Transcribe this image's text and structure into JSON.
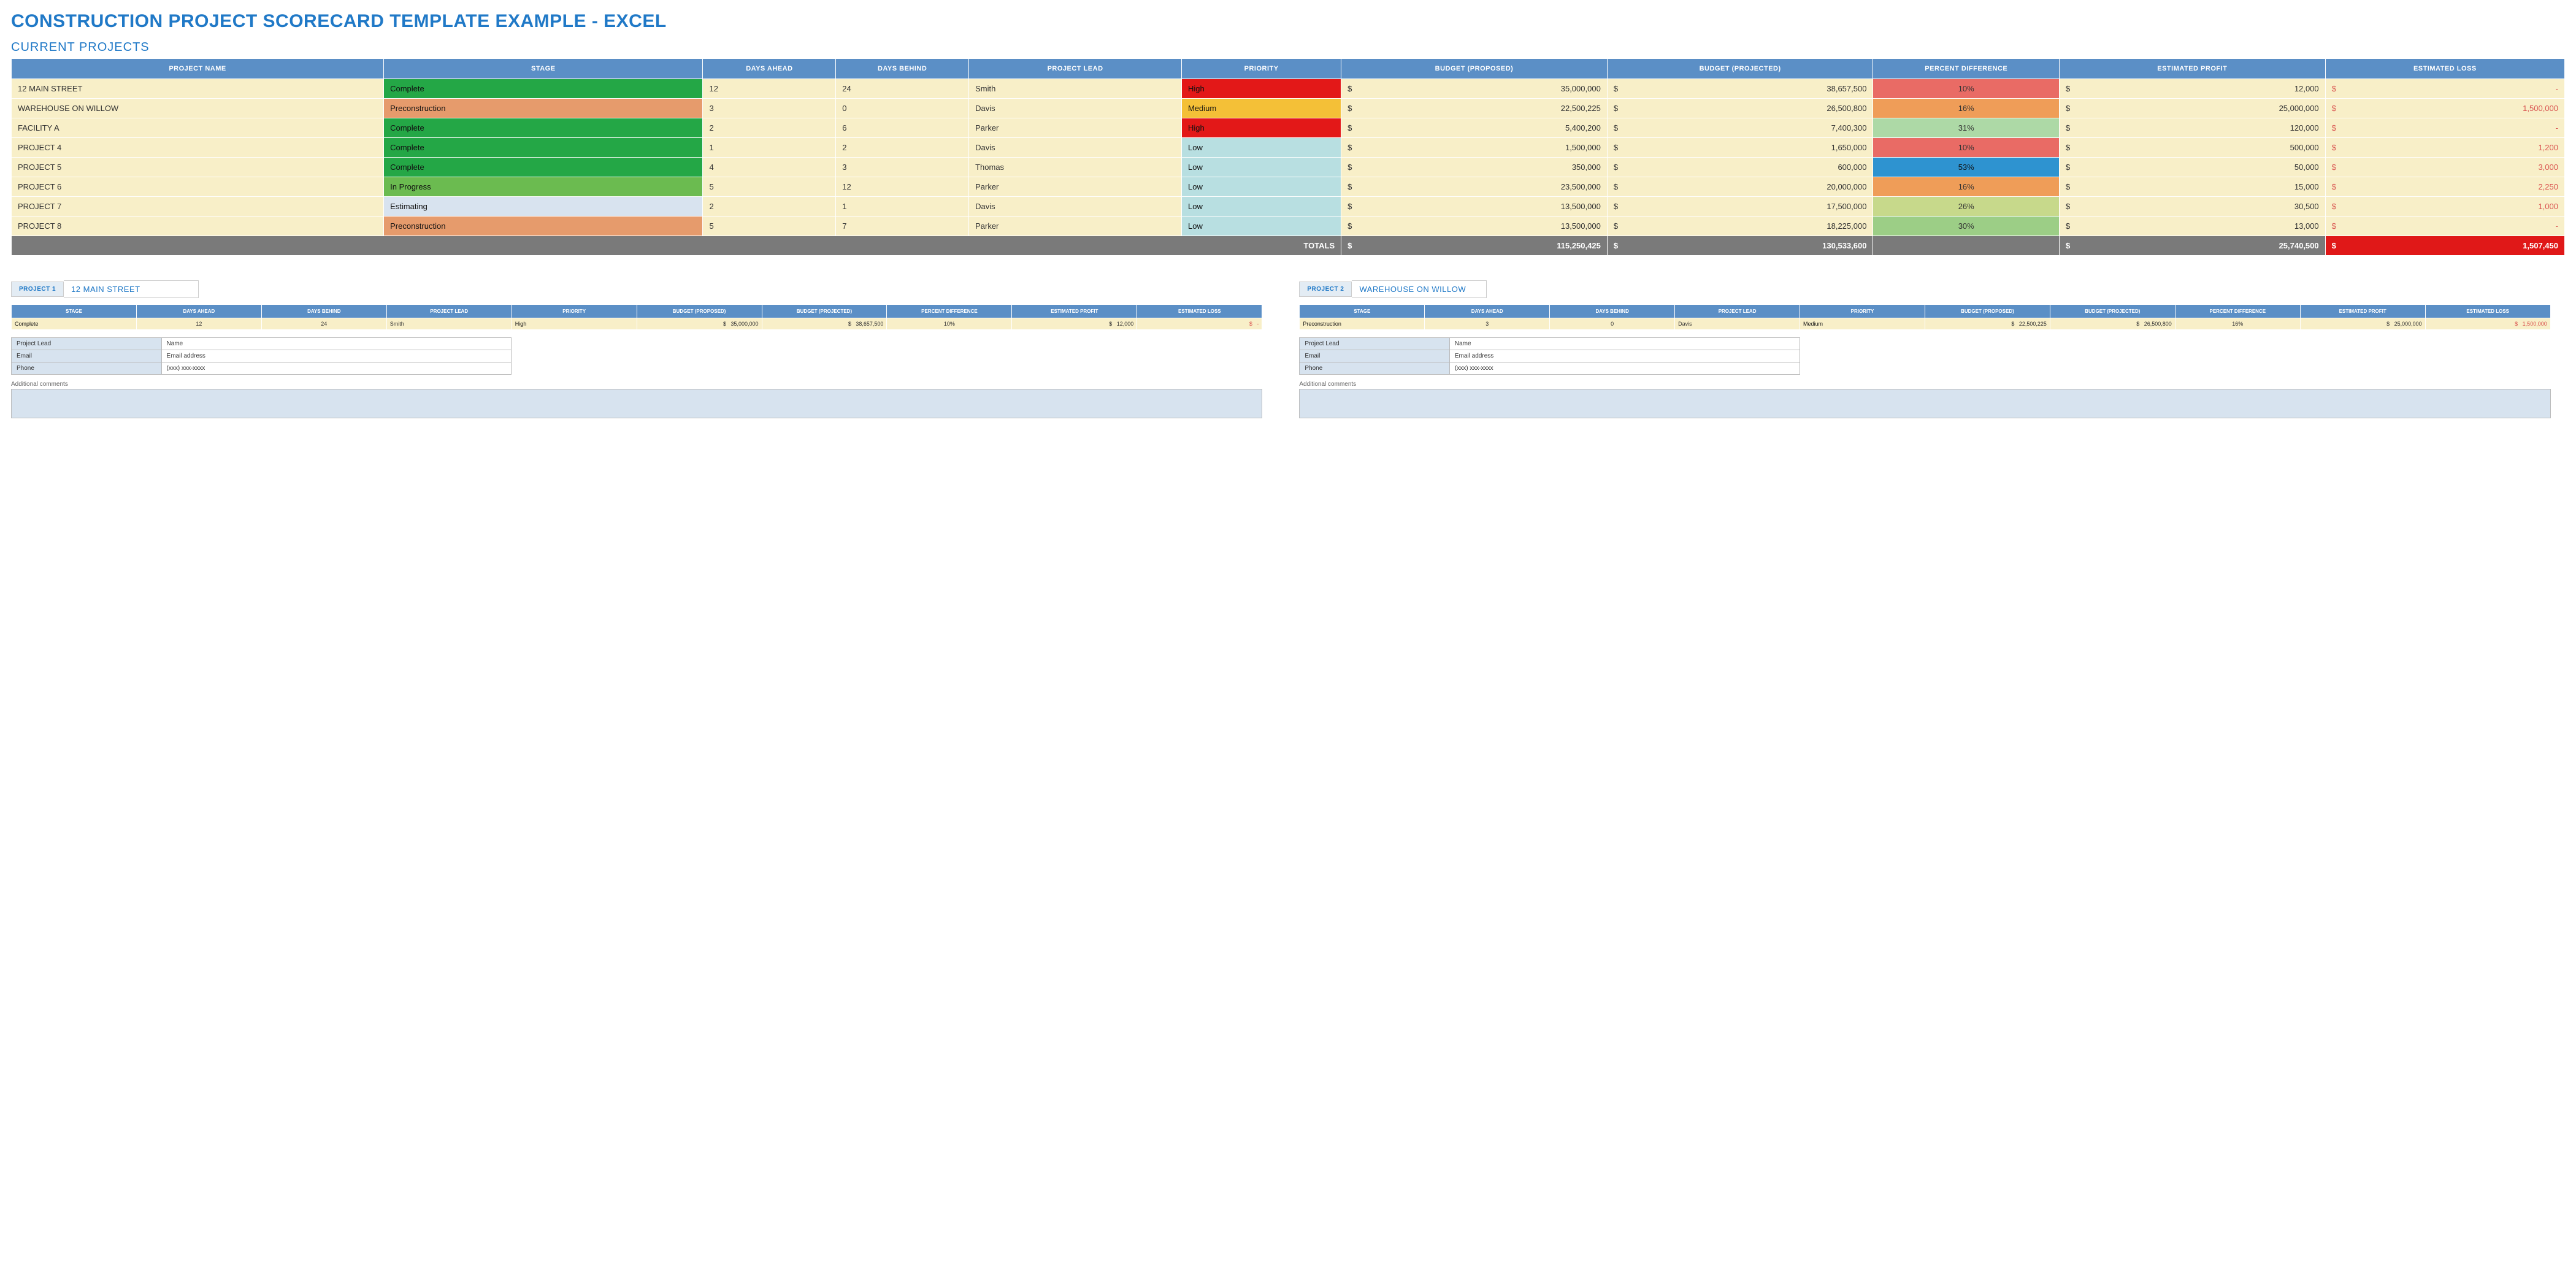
{
  "title": "CONSTRUCTION PROJECT SCORECARD TEMPLATE EXAMPLE - EXCEL",
  "section": "CURRENT PROJECTS",
  "columns": {
    "name": "PROJECT NAME",
    "stage": "STAGE",
    "ahead": "DAYS AHEAD",
    "behind": "DAYS BEHIND",
    "lead": "PROJECT LEAD",
    "priority": "PRIORITY",
    "budget_prop": "BUDGET (PROPOSED)",
    "budget_proj": "BUDGET (PROJECTED)",
    "pct": "PERCENT DIFFERENCE",
    "profit": "ESTIMATED PROFIT",
    "loss": "ESTIMATED LOSS"
  },
  "rows": [
    {
      "name": "12 MAIN STREET",
      "stage": "Complete",
      "ahead": "12",
      "behind": "24",
      "lead": "Smith",
      "priority": "High",
      "budget_prop": "35,000,000",
      "budget_proj": "38,657,500",
      "pct": "10%",
      "pct_class": "pct-red",
      "profit": "12,000",
      "loss": "-"
    },
    {
      "name": "WAREHOUSE ON WILLOW",
      "stage": "Preconstruction",
      "ahead": "3",
      "behind": "0",
      "lead": "Davis",
      "priority": "Medium",
      "budget_prop": "22,500,225",
      "budget_proj": "26,500,800",
      "pct": "16%",
      "pct_class": "pct-orange",
      "profit": "25,000,000",
      "loss": "1,500,000"
    },
    {
      "name": "FACILITY A",
      "stage": "Complete",
      "ahead": "2",
      "behind": "6",
      "lead": "Parker",
      "priority": "High",
      "budget_prop": "5,400,200",
      "budget_proj": "7,400,300",
      "pct": "31%",
      "pct_class": "pct-lightgreen",
      "profit": "120,000",
      "loss": "-"
    },
    {
      "name": "PROJECT 4",
      "stage": "Complete",
      "ahead": "1",
      "behind": "2",
      "lead": "Davis",
      "priority": "Low",
      "budget_prop": "1,500,000",
      "budget_proj": "1,650,000",
      "pct": "10%",
      "pct_class": "pct-red",
      "profit": "500,000",
      "loss": "1,200"
    },
    {
      "name": "PROJECT 5",
      "stage": "Complete",
      "ahead": "4",
      "behind": "3",
      "lead": "Thomas",
      "priority": "Low",
      "budget_prop": "350,000",
      "budget_proj": "600,000",
      "pct": "53%",
      "pct_class": "pct-blue",
      "profit": "50,000",
      "loss": "3,000"
    },
    {
      "name": "PROJECT 6",
      "stage": "In Progress",
      "ahead": "5",
      "behind": "12",
      "lead": "Parker",
      "priority": "Low",
      "budget_prop": "23,500,000",
      "budget_proj": "20,000,000",
      "pct": "16%",
      "pct_class": "pct-orange",
      "profit": "15,000",
      "loss": "2,250"
    },
    {
      "name": "PROJECT 7",
      "stage": "Estimating",
      "ahead": "2",
      "behind": "1",
      "lead": "Davis",
      "priority": "Low",
      "budget_prop": "13,500,000",
      "budget_proj": "17,500,000",
      "pct": "26%",
      "pct_class": "pct-olive",
      "profit": "30,500",
      "loss": "1,000"
    },
    {
      "name": "PROJECT 8",
      "stage": "Preconstruction",
      "ahead": "5",
      "behind": "7",
      "lead": "Parker",
      "priority": "Low",
      "budget_prop": "13,500,000",
      "budget_proj": "18,225,000",
      "pct": "30%",
      "pct_class": "pct-green2",
      "profit": "13,000",
      "loss": "-"
    }
  ],
  "totals": {
    "label": "TOTALS",
    "budget_prop": "115,250,425",
    "budget_proj": "130,533,600",
    "profit": "25,740,500",
    "loss": "1,507,450"
  },
  "cards": [
    {
      "label": "PROJECT 1",
      "name": "12 MAIN STREET",
      "row": {
        "stage": "Complete",
        "ahead": "12",
        "behind": "24",
        "lead": "Smith",
        "priority": "High",
        "budget_prop": "35,000,000",
        "budget_proj": "38,657,500",
        "pct": "10%",
        "profit": "12,000",
        "loss": "-"
      },
      "stage_class": "Complete",
      "pri_class": "High"
    },
    {
      "label": "PROJECT 2",
      "name": "WAREHOUSE ON WILLOW",
      "row": {
        "stage": "Preconstruction",
        "ahead": "3",
        "behind": "0",
        "lead": "Davis",
        "priority": "Medium",
        "budget_prop": "22,500,225",
        "budget_proj": "26,500,800",
        "pct": "16%",
        "profit": "25,000,000",
        "loss": "1,500,000"
      },
      "stage_class": "Preconstruction",
      "pri_class": "Medium"
    }
  ],
  "contact": {
    "lead_key": "Project Lead",
    "lead_val": "Name",
    "email_key": "Email",
    "email_val": "Email address",
    "phone_key": "Phone",
    "phone_val": "(xxx) xxx-xxxx"
  },
  "comments_label": "Additional comments",
  "currency": "$"
}
